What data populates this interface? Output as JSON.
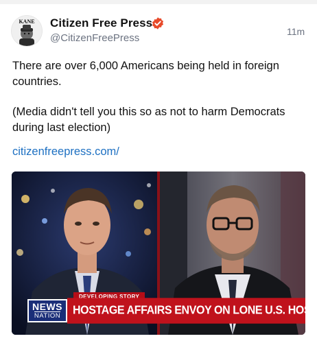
{
  "post": {
    "author_name": "Citizen Free Press",
    "handle": "@CitizenFreePress",
    "timestamp": "11m",
    "avatar_text": "KANE",
    "text_line1": "There are over 6,000 Americans being held in foreign countries.",
    "text_line2": "(Media didn't tell you this so as not to harm Democrats during last election)",
    "link": "citizenfreepress.com/"
  },
  "media": {
    "tag": "DEVELOPING STORY",
    "headline": "HOSTAGE AFFAIRS ENVOY ON LONE U.S. HOSTAGE",
    "network_line1": "NEWS",
    "network_line2": "NATION"
  },
  "colors": {
    "accent_link": "#1d70c2",
    "verified_badge": "#e84a2a",
    "banner_red": "#c0121c",
    "logo_blue": "#1a2e78"
  },
  "icons": [
    "verified-icon"
  ]
}
